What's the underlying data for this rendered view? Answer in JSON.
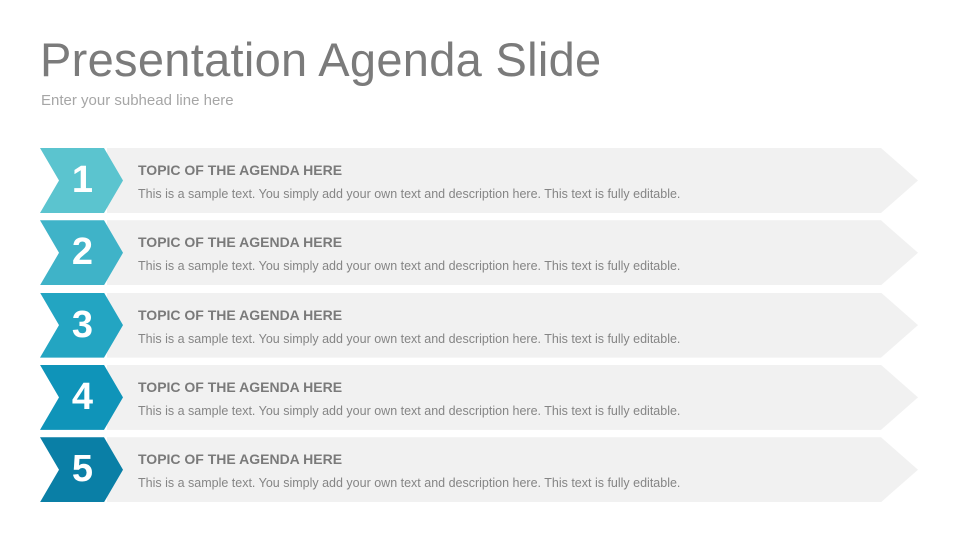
{
  "slide": {
    "title": "Presentation Agenda Slide",
    "subtitle": "Enter your subhead line here"
  },
  "agenda": {
    "items": [
      {
        "number": "1",
        "title": "TOPIC OF THE AGENDA HERE",
        "text": "This is a sample text. You simply add your own text and description here. This text is fully editable.",
        "color": "#5bc4cf"
      },
      {
        "number": "2",
        "title": "TOPIC OF THE AGENDA HERE",
        "text": "This is a sample text. You simply add your own text and description here. This text is fully editable.",
        "color": "#3fb3c8"
      },
      {
        "number": "3",
        "title": "TOPIC OF THE AGENDA HERE",
        "text": "This is a sample text. You simply add your own text and description here. This text is fully editable.",
        "color": "#23a5c2"
      },
      {
        "number": "4",
        "title": "TOPIC OF THE AGENDA HERE",
        "text": "This is a sample text. You simply add your own text and description here. This text is fully editable.",
        "color": "#0f94b9"
      },
      {
        "number": "5",
        "title": "TOPIC OF THE AGENDA HERE",
        "text": "This is a sample text. You simply add your own text and description here. This text is fully editable.",
        "color": "#0a7fa6"
      }
    ],
    "bar_color": "#f1f1f1"
  }
}
